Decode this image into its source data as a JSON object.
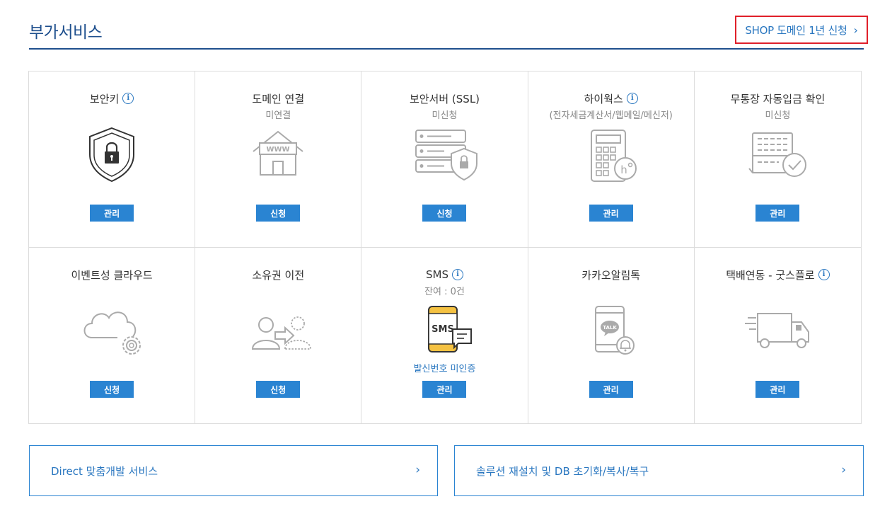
{
  "header": {
    "title": "부가서비스",
    "shop_link": "SHOP 도메인 1년 신청",
    "shop_link_chevron": "›"
  },
  "services": [
    {
      "title": "보안키",
      "info": true,
      "sub": "",
      "icon": "security-shield-lock-icon",
      "button": "관리"
    },
    {
      "title": "도메인 연결",
      "info": false,
      "sub": "미연결",
      "icon": "domain-www-house-icon",
      "button": "신청"
    },
    {
      "title": "보안서버 (SSL)",
      "info": false,
      "sub": "미신청",
      "icon": "server-shield-lock-icon",
      "button": "신청"
    },
    {
      "title": "하이웍스",
      "info": true,
      "sub": "(전자세금계산서/웹메일/메신저)",
      "icon": "calculator-hiworks-icon",
      "button": "관리"
    },
    {
      "title": "무통장 자동입금 확인",
      "info": false,
      "sub": "미신청",
      "icon": "bankbook-check-icon",
      "button": "관리"
    },
    {
      "title": "이벤트성 클라우드",
      "info": false,
      "sub": "",
      "icon": "cloud-gear-icon",
      "button": "신청"
    },
    {
      "title": "소유권 이전",
      "info": false,
      "sub": "",
      "icon": "ownership-transfer-icon",
      "button": "신청"
    },
    {
      "title": "SMS",
      "info": true,
      "sub": "잔여 : 0건",
      "icon": "sms-phone-icon",
      "link": "발신번호 미인증",
      "button": "관리"
    },
    {
      "title": "카카오알림톡",
      "info": false,
      "sub": "",
      "icon": "kakao-talk-bell-icon",
      "button": "관리"
    },
    {
      "title": "택배연동 - 굿스플로",
      "info": true,
      "sub": "",
      "icon": "delivery-truck-icon",
      "button": "관리"
    }
  ],
  "bottom": {
    "left": "Direct 맞춤개발 서비스",
    "right": "솔루션 재설치 및 DB 초기화/복사/복구",
    "chevron": "›"
  },
  "colors": {
    "brand_navy": "#1e4f8d",
    "link_blue": "#2a77c0",
    "button_blue": "#2a84d2",
    "highlight_red": "#e0202a",
    "sms_yellow": "#f5c242"
  },
  "info_glyph": "i"
}
